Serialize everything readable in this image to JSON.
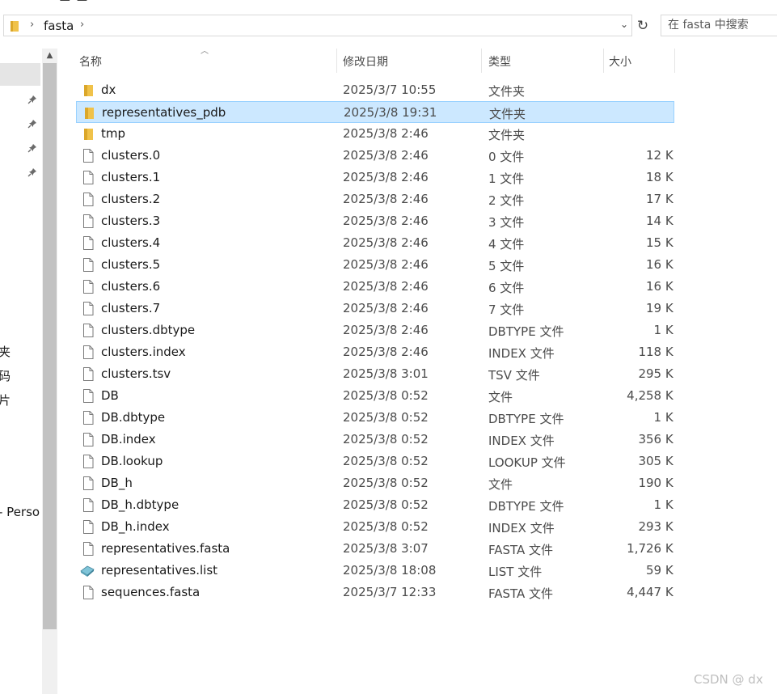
{
  "window": {
    "top_fragments": [
      "·     ·      —  —"
    ]
  },
  "address_bar": {
    "breadcrumb": [
      "fasta"
    ],
    "separator": "›",
    "dropdown_glyph": "⌄",
    "refresh_glyph": "↻"
  },
  "search": {
    "placeholder": "在 fasta 中搜索"
  },
  "nav_pane": {
    "labels": [
      "夹",
      "码",
      "片",
      "- Perso"
    ]
  },
  "columns": {
    "name": "名称",
    "date": "修改日期",
    "type": "类型",
    "size": "大小"
  },
  "files": [
    {
      "name": "dx",
      "date": "2025/3/7 10:55",
      "type": "文件夹",
      "size": "",
      "icon": "folder-icon"
    },
    {
      "name": "representatives_pdb",
      "date": "2025/3/8 19:31",
      "type": "文件夹",
      "size": "",
      "icon": "folder-icon",
      "selected": true
    },
    {
      "name": "tmp",
      "date": "2025/3/8 2:46",
      "type": "文件夹",
      "size": "",
      "icon": "folder-icon"
    },
    {
      "name": "clusters.0",
      "date": "2025/3/8 2:46",
      "type": "0 文件",
      "size": "12 KB",
      "icon": "file-icon"
    },
    {
      "name": "clusters.1",
      "date": "2025/3/8 2:46",
      "type": "1 文件",
      "size": "18 KB",
      "icon": "file-icon"
    },
    {
      "name": "clusters.2",
      "date": "2025/3/8 2:46",
      "type": "2 文件",
      "size": "17 KB",
      "icon": "file-icon"
    },
    {
      "name": "clusters.3",
      "date": "2025/3/8 2:46",
      "type": "3 文件",
      "size": "14 KB",
      "icon": "file-icon"
    },
    {
      "name": "clusters.4",
      "date": "2025/3/8 2:46",
      "type": "4 文件",
      "size": "15 KB",
      "icon": "file-icon"
    },
    {
      "name": "clusters.5",
      "date": "2025/3/8 2:46",
      "type": "5 文件",
      "size": "16 KB",
      "icon": "file-icon"
    },
    {
      "name": "clusters.6",
      "date": "2025/3/8 2:46",
      "type": "6 文件",
      "size": "16 KB",
      "icon": "file-icon"
    },
    {
      "name": "clusters.7",
      "date": "2025/3/8 2:46",
      "type": "7 文件",
      "size": "19 KB",
      "icon": "file-icon"
    },
    {
      "name": "clusters.dbtype",
      "date": "2025/3/8 2:46",
      "type": "DBTYPE 文件",
      "size": "1 KB",
      "icon": "file-icon"
    },
    {
      "name": "clusters.index",
      "date": "2025/3/8 2:46",
      "type": "INDEX 文件",
      "size": "118 KB",
      "icon": "file-icon"
    },
    {
      "name": "clusters.tsv",
      "date": "2025/3/8 3:01",
      "type": "TSV 文件",
      "size": "295 KB",
      "icon": "file-icon"
    },
    {
      "name": "DB",
      "date": "2025/3/8 0:52",
      "type": "文件",
      "size": "4,258 KB",
      "icon": "file-icon"
    },
    {
      "name": "DB.dbtype",
      "date": "2025/3/8 0:52",
      "type": "DBTYPE 文件",
      "size": "1 KB",
      "icon": "file-icon"
    },
    {
      "name": "DB.index",
      "date": "2025/3/8 0:52",
      "type": "INDEX 文件",
      "size": "356 KB",
      "icon": "file-icon"
    },
    {
      "name": "DB.lookup",
      "date": "2025/3/8 0:52",
      "type": "LOOKUP 文件",
      "size": "305 KB",
      "icon": "file-icon"
    },
    {
      "name": "DB_h",
      "date": "2025/3/8 0:52",
      "type": "文件",
      "size": "190 KB",
      "icon": "file-icon"
    },
    {
      "name": "DB_h.dbtype",
      "date": "2025/3/8 0:52",
      "type": "DBTYPE 文件",
      "size": "1 KB",
      "icon": "file-icon"
    },
    {
      "name": "DB_h.index",
      "date": "2025/3/8 0:52",
      "type": "INDEX 文件",
      "size": "293 KB",
      "icon": "file-icon"
    },
    {
      "name": "representatives.fasta",
      "date": "2025/3/8 3:07",
      "type": "FASTA 文件",
      "size": "1,726 KB",
      "icon": "file-icon"
    },
    {
      "name": "representatives.list",
      "date": "2025/3/8 18:08",
      "type": "LIST 文件",
      "size": "59 KB",
      "icon": "list-file-icon"
    },
    {
      "name": "sequences.fasta",
      "date": "2025/3/7 12:33",
      "type": "FASTA 文件",
      "size": "4,447 KB",
      "icon": "file-icon"
    }
  ],
  "watermark": "CSDN @ dx",
  "colors": {
    "selection_bg": "#cce8ff",
    "selection_border": "#99d1ff",
    "folder": "#f0c24a",
    "folder_dark": "#dba72a"
  }
}
